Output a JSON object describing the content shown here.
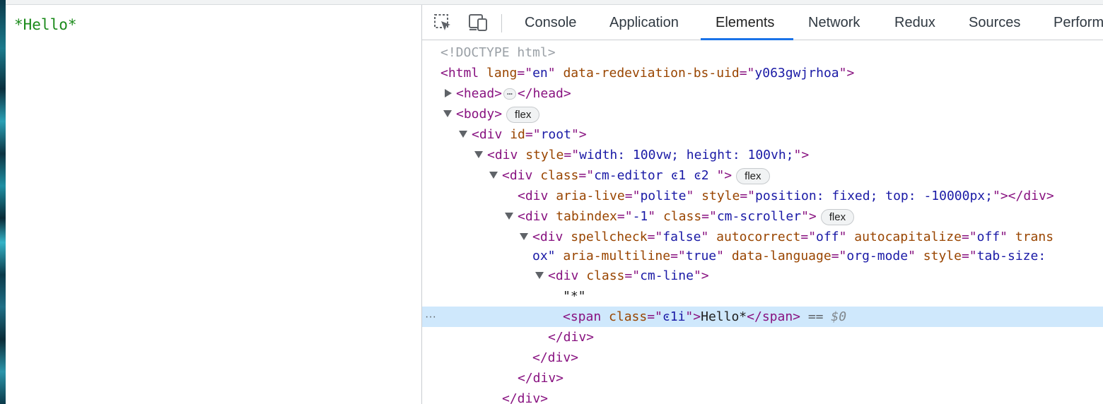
{
  "page": {
    "editor_text": "*Hello*"
  },
  "devtools": {
    "toolbar": {
      "inspect_icon": "inspect-element-icon",
      "device_icon": "device-toolbar-icon",
      "tabs": [
        {
          "label": "Console",
          "active": false
        },
        {
          "label": "Application",
          "active": false
        },
        {
          "label": "Elements",
          "active": true
        },
        {
          "label": "Network",
          "active": false
        },
        {
          "label": "Redux",
          "active": false
        },
        {
          "label": "Sources",
          "active": false
        },
        {
          "label": "Perform",
          "active": false
        }
      ]
    },
    "tree": {
      "doctype": "<!DOCTYPE html>",
      "html": {
        "tag": "html",
        "attrs": [
          {
            "name": "lang",
            "value": "en"
          },
          {
            "name": "data-redeviation-bs-uid",
            "value": "y063gwjrhoa"
          }
        ]
      },
      "head": {
        "open": "<head>",
        "ellipsis": "…",
        "close": "</head>"
      },
      "body": {
        "tag": "body",
        "badge": "flex"
      },
      "root_div": {
        "tag": "div",
        "attr": "id",
        "value": "root"
      },
      "style_div": {
        "tag": "div",
        "attr": "style",
        "value": "width: 100vw; height: 100vh;"
      },
      "editor_div": {
        "tag": "div",
        "attr": "class",
        "value": "cm-editor ͼ1 ͼ2 ",
        "badge": "flex"
      },
      "aria_div": {
        "attr1": "aria-live",
        "val1": "polite",
        "attr2": "style",
        "val2": "position: fixed; top: -10000px;",
        "close": "></div>"
      },
      "scroller_div": {
        "attr1": "tabindex",
        "val1": "-1",
        "attr2": "class",
        "val2": "cm-scroller",
        "badge": "flex"
      },
      "content_div": {
        "line1": {
          "attr1": "spellcheck",
          "val1": "false",
          "attr2": "autocorrect",
          "val2": "off",
          "attr3": "autocapitalize",
          "val3": "off",
          "attr4": "trans"
        },
        "line2": {
          "prefix": "ox\" ",
          "attr1": "aria-multiline",
          "val1": "true",
          "attr2": "data-language",
          "val2": "org-mode",
          "attr3": "style",
          "val3": "tab-size: "
        }
      },
      "line_div": {
        "tag": "div",
        "attr": "class",
        "value": "cm-line"
      },
      "text_node": "\"*\"",
      "selected_span": {
        "attr": "class",
        "value": "ͼ1i",
        "text": "Hello*",
        "eq": "==",
        "ref": "$0"
      },
      "closing": [
        "</div>",
        "</div>",
        "</div>",
        "</div>"
      ],
      "gutter_dots": "···"
    }
  }
}
